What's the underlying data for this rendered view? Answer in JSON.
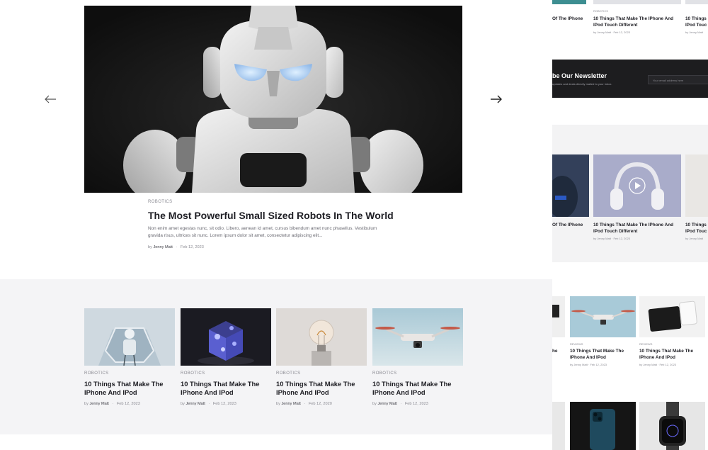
{
  "hero": {
    "category": "ROBOTICS",
    "title": "The Most Powerful Small Sized Robots In The World",
    "excerpt": "Non enim amet egestas nunc, sit odio. Libero, aenean id amet, cursus bibendum amet nunc phasellus. Vestibulum gravida risus, ultrices sit nunc. Lorem ipsum dolor sit amet, consectetur adipiscing elit...",
    "by": "by",
    "author": "Jenny Matt",
    "date": "Feb 12, 2023"
  },
  "cards": [
    {
      "category": "ROBOTICS",
      "title": "10 Things That Make The IPhone And IPod",
      "by": "by",
      "author": "Jenny Matt",
      "date": "Feb 12, 2023"
    },
    {
      "category": "ROBOTICS",
      "title": "10 Things That Make The IPhone And IPod",
      "by": "by",
      "author": "Jenny Matt",
      "date": "Feb 12, 2023"
    },
    {
      "category": "ROBOTICS",
      "title": "10 Things That Make The IPhone And IPod",
      "by": "by",
      "author": "Jenny Matt",
      "date": "Feb 12, 2020"
    },
    {
      "category": "ROBOTICS",
      "title": "10 Things That Make The IPhone And IPod",
      "by": "by",
      "author": "Jenny Matt",
      "date": "Feb 12, 2023"
    }
  ],
  "side": {
    "top_left_title": "Of The IPhone",
    "top_mid_category": "ROBOTICS",
    "top_mid_title_1": "10 Things That Make The IPhone And",
    "top_mid_title_2": "IPod Touch Different",
    "top_mid_meta": "by Jenny Matt  ·  Feb 12, 2023",
    "top_right_title_1": "10 Things",
    "top_right_title_2": "IPod Touc",
    "top_right_meta": "by Jenny Matt",
    "newsletter_title": "be Our Newsletter",
    "newsletter_sub": "updates and deals directly mailed to your inbox.",
    "newsletter_placeholder": "Your email address here",
    "mid_left_title": "Of The IPhone",
    "mid_mid_title_1": "10 Things That Make The IPhone And",
    "mid_mid_title_2": "IPod Touch Different",
    "mid_mid_meta": "by Jenny Matt  ·  Feb 12, 2023",
    "mid_right_title_1": "10 Things",
    "mid_right_title_2": "IPod Touc",
    "mid_right_meta": "by Jenny Matt",
    "low_left_title": "he",
    "low_a_category": "REVIEWS",
    "low_a_title_1": "10 Things That Make The",
    "low_a_title_2": "IPhone And IPod",
    "low_a_meta": "by Jenny Matt  ·  Feb 12, 2023",
    "low_b_category": "REVIEWS",
    "low_b_title_1": "10 Things That Make The",
    "low_b_title_2": "IPhone And IPod",
    "low_b_meta": "by Jenny Matt  ·  Feb 12, 2023"
  }
}
